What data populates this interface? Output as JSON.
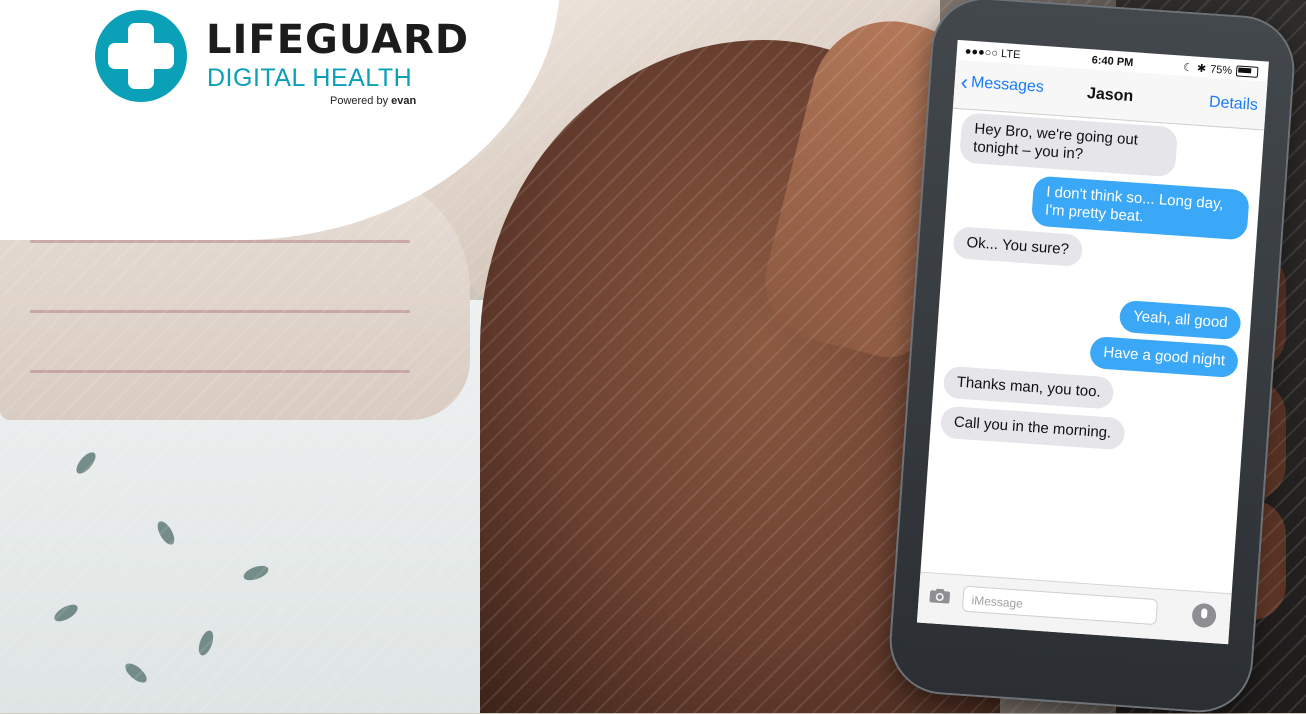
{
  "brand": {
    "title": "LIFEGUARD",
    "subtitle": "DIGITAL HEALTH",
    "powered_by_prefix": "Powered by",
    "powered_by_name": "evan",
    "accent_color": "#0aa0b8"
  },
  "phone": {
    "status": {
      "signal": "●●●○○ LTE",
      "time": "6:40 PM",
      "battery": "75%"
    },
    "nav": {
      "back_label": "Messages",
      "contact_name": "Jason",
      "details_label": "Details"
    },
    "messages": [
      {
        "from": "them",
        "text": "Hey Bro, we're going out tonight – you in?"
      },
      {
        "from": "me",
        "text": "I don't think so... Long day, I'm pretty beat."
      },
      {
        "from": "them",
        "text": "Ok... You sure?"
      },
      {
        "from": "me",
        "text": "Yeah, all good"
      },
      {
        "from": "me",
        "text": "Have a good night"
      },
      {
        "from": "them",
        "text": "Thanks man, you too."
      },
      {
        "from": "them",
        "text": "Call you in the morning."
      }
    ],
    "composer": {
      "placeholder": "iMessage"
    },
    "colors": {
      "outgoing_bubble": "#3aa8f7",
      "incoming_bubble": "#e5e5ea",
      "link_blue": "#1a7cf5"
    }
  }
}
